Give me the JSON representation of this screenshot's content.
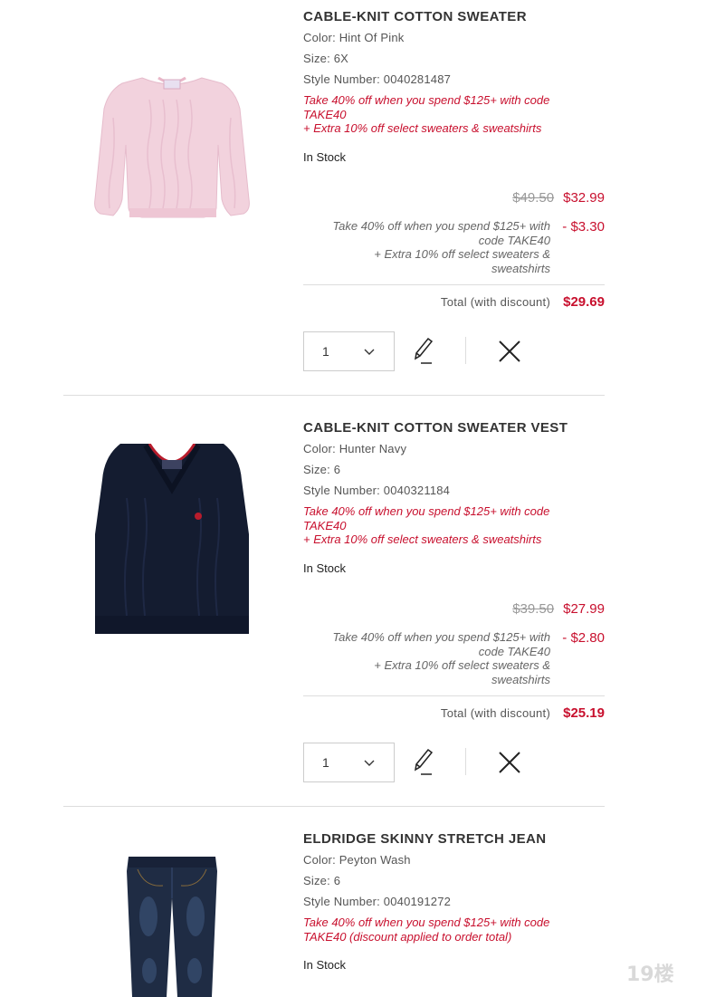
{
  "items": [
    {
      "title": "CABLE-KNIT COTTON SWEATER",
      "color": "Color: Hint Of Pink",
      "size": "Size: 6X",
      "style": "Style Number: 0040281487",
      "promo_line1": "Take 40% off when you spend $125+ with code",
      "promo_line2": "TAKE40",
      "promo_line3": "+ Extra 10% off select sweaters & sweatshirts",
      "stock": "In Stock",
      "old_price": "$49.50",
      "new_price": "$32.99",
      "disc_line1": "Take 40% off when you spend $125+ with",
      "disc_line2": "code TAKE40",
      "disc_line3": "+ Extra 10% off select sweaters &",
      "disc_line4": "sweatshirts",
      "disc_amount": "- $3.30",
      "total_label": "Total (with discount)",
      "total": "$29.69",
      "qty": "1",
      "image_color": "#f3d3de"
    },
    {
      "title": "CABLE-KNIT COTTON SWEATER VEST",
      "color": "Color: Hunter Navy",
      "size": "Size: 6",
      "style": "Style Number: 0040321184",
      "promo_line1": "Take 40% off when you spend $125+ with code",
      "promo_line2": "TAKE40",
      "promo_line3": "+ Extra 10% off select sweaters & sweatshirts",
      "stock": "In Stock",
      "old_price": "$39.50",
      "new_price": "$27.99",
      "disc_line1": "Take 40% off when you spend $125+ with",
      "disc_line2": "code TAKE40",
      "disc_line3": "+ Extra 10% off select sweaters &",
      "disc_line4": "sweatshirts",
      "disc_amount": "- $2.80",
      "total_label": "Total (with discount)",
      "total": "$25.19",
      "qty": "1",
      "image_color": "#141c30"
    },
    {
      "title": "ELDRIDGE SKINNY STRETCH JEAN",
      "color": "Color: Peyton Wash",
      "size": "Size: 6",
      "style": "Style Number: 0040191272",
      "promo_line1": "Take 40% off when you spend $125+ with code",
      "promo_line2": "TAKE40 (discount applied to order total)",
      "stock": "In Stock",
      "image_color": "#1f2c44"
    }
  ],
  "colors": {
    "accent_red": "#c8102e",
    "divider": "#dddddd"
  },
  "icons": {
    "edit": "pencil-icon",
    "remove": "close-icon",
    "qty_dropdown": "chevron-down-icon"
  },
  "watermark": "19楼"
}
